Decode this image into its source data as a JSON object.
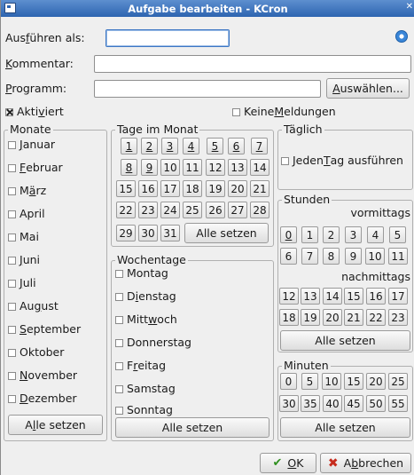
{
  "window": {
    "title": "Aufgabe bearbeiten - KCron"
  },
  "form": {
    "execute_as": {
      "label_pre": "Aus",
      "label_key": "f",
      "label_post": "ühren als:",
      "value": ""
    },
    "comment": {
      "label_key": "K",
      "label_post": "ommentar:",
      "value": ""
    },
    "program": {
      "label_key": "P",
      "label_post": "rogramm:",
      "value": ""
    },
    "browse_button": {
      "key": "A",
      "post": "uswählen..."
    },
    "enabled": {
      "pre": "Akti",
      "key": "v",
      "post": "iert",
      "checked": true
    },
    "no_notifications": {
      "pre": "Keine ",
      "key": "M",
      "post": "eldungen",
      "checked": false
    }
  },
  "months": {
    "title": "Monate",
    "items": [
      {
        "pre": "",
        "key": "J",
        "post": "anuar"
      },
      {
        "pre": "",
        "key": "F",
        "post": "ebruar"
      },
      {
        "pre": "M",
        "key": "ä",
        "post": "rz"
      },
      {
        "pre": "April",
        "key": "",
        "post": ""
      },
      {
        "pre": "Mai",
        "key": "",
        "post": ""
      },
      {
        "pre": "",
        "key": "J",
        "post": "uni"
      },
      {
        "pre": "",
        "key": "J",
        "post": "uli"
      },
      {
        "pre": "Au",
        "key": "g",
        "post": "ust"
      },
      {
        "pre": "",
        "key": "S",
        "post": "eptember"
      },
      {
        "pre": "Oktober",
        "key": "",
        "post": ""
      },
      {
        "pre": "",
        "key": "N",
        "post": "ovember"
      },
      {
        "pre": "",
        "key": "D",
        "post": "ezember"
      }
    ],
    "set_all": {
      "pre": "A",
      "key": "l",
      "post": "le setzen"
    }
  },
  "days_of_month": {
    "title": "Tage im Monat",
    "days": [
      "1",
      "2",
      "3",
      "4",
      "5",
      "6",
      "7",
      "8",
      "9",
      "10",
      "11",
      "12",
      "13",
      "14",
      "15",
      "16",
      "17",
      "18",
      "19",
      "20",
      "21",
      "22",
      "23",
      "24",
      "25",
      "26",
      "27",
      "28",
      "29",
      "30",
      "31"
    ],
    "set_all": "Alle setzen"
  },
  "weekdays": {
    "title": "Wochentage",
    "items": [
      {
        "pre": "Montag",
        "key": "",
        "post": ""
      },
      {
        "pre": "D",
        "key": "i",
        "post": "enstag"
      },
      {
        "pre": "Mitt",
        "key": "w",
        "post": "och"
      },
      {
        "pre": "Donnerstag",
        "key": "",
        "post": ""
      },
      {
        "pre": "F",
        "key": "r",
        "post": "eitag"
      },
      {
        "pre": "Samstag",
        "key": "",
        "post": ""
      },
      {
        "pre": "Sonntag",
        "key": "",
        "post": ""
      }
    ],
    "set_all": "Alle setzen"
  },
  "daily": {
    "title": "Täglich",
    "every_day": {
      "pre": "Jeden ",
      "key": "T",
      "post": "ag ausführen"
    }
  },
  "hours": {
    "title": "Stunden",
    "am_label": "vormittags",
    "pm_label": "nachmittags",
    "am": [
      "0",
      "1",
      "2",
      "3",
      "4",
      "5",
      "6",
      "7",
      "8",
      "9",
      "10",
      "11"
    ],
    "pm": [
      "12",
      "13",
      "14",
      "15",
      "16",
      "17",
      "18",
      "19",
      "20",
      "21",
      "22",
      "23"
    ],
    "set_all": "Alle setzen"
  },
  "minutes": {
    "title": "Minuten",
    "values": [
      "0",
      "5",
      "10",
      "15",
      "20",
      "25",
      "30",
      "35",
      "40",
      "45",
      "50",
      "55"
    ],
    "set_all": "Alle setzen"
  },
  "footer": {
    "ok": {
      "key": "O",
      "post": "K"
    },
    "cancel": {
      "pre": "A",
      "key": "b",
      "post": "brechen"
    }
  },
  "icons": {
    "app": "kcron-window-icon",
    "help": "help-icon",
    "ok": "checkmark-icon",
    "cancel": "cross-icon"
  },
  "colors": {
    "titlebar": "#2d64b0",
    "ok_icon": "#2f8f1f",
    "cancel_icon": "#c62b1c"
  }
}
